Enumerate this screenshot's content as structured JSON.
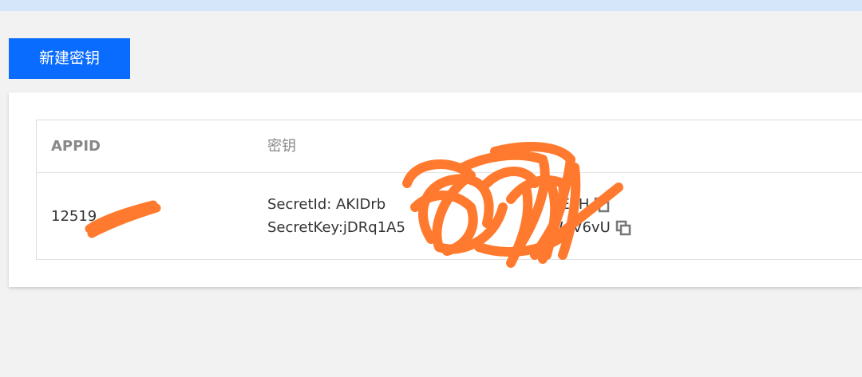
{
  "toolbar": {
    "new_key_label": "新建密钥"
  },
  "table": {
    "columns": [
      "APPID",
      "密钥"
    ],
    "rows": [
      {
        "appid_visible": "12519",
        "secret_id_prefix": "SecretId: AKIDrb",
        "secret_id_suffix": "IEYH",
        "secret_key_prefix": "SecretKey:jDRq1A5",
        "secret_key_suffix": "WdV6vU"
      }
    ]
  },
  "icons": {
    "copy": "copy-icon"
  },
  "colors": {
    "accent": "#0a6cff",
    "banner": "#d5e6fb",
    "redaction": "#ff7a2e"
  }
}
